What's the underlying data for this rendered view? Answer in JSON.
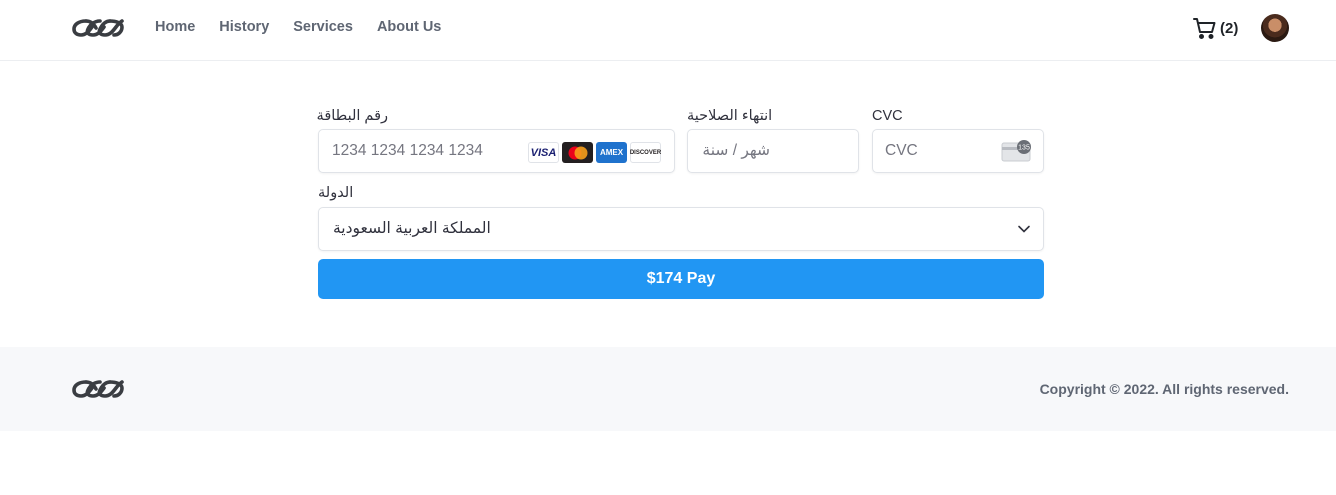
{
  "header": {
    "logo_icon": "infinity-chain-logo-icon",
    "nav": [
      {
        "label": "Home"
      },
      {
        "label": "History"
      },
      {
        "label": "Services"
      },
      {
        "label": "About Us"
      }
    ],
    "cart": {
      "icon": "cart-icon",
      "count": "(2)"
    },
    "avatar_icon": "user-avatar"
  },
  "payment": {
    "card_number": {
      "label": "رقم البطاقة",
      "placeholder": "1234 1234 1234 1234"
    },
    "expiry": {
      "label": "انتهاء الصلاحية",
      "placeholder": "شهر / سنة"
    },
    "cvc": {
      "label": "CVC",
      "placeholder": "CVC",
      "icon": "card-cvc-icon",
      "icon_text": "135"
    },
    "card_brands": [
      {
        "name": "VISA",
        "icon": "visa-icon"
      },
      {
        "name": "",
        "icon": "mastercard-icon"
      },
      {
        "name": "AMEX",
        "icon": "amex-icon"
      },
      {
        "name": "DISCOVER",
        "icon": "discover-icon"
      }
    ],
    "country": {
      "label": "الدولة",
      "value": "المملكة العربية السعودية"
    },
    "pay_button": "$174 Pay"
  },
  "footer": {
    "logo_icon": "infinity-chain-logo-icon",
    "copyright": "Copyright © 2022. All rights reserved."
  },
  "colors": {
    "accent": "#2196f3",
    "nav_text": "#5f6673",
    "footer_bg": "#f7f8fa"
  }
}
